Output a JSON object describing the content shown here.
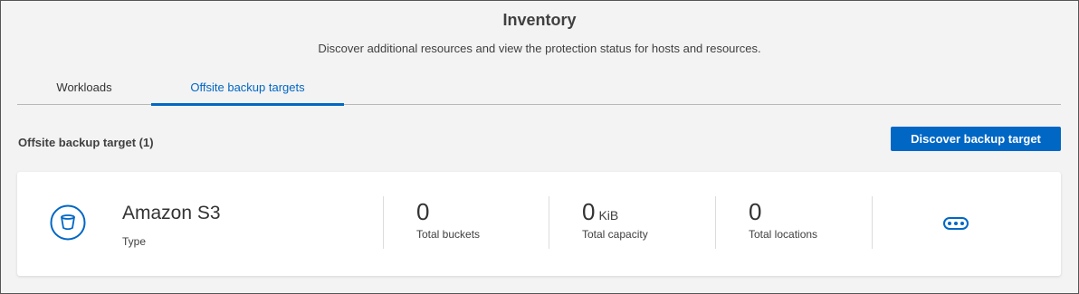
{
  "header": {
    "title": "Inventory",
    "subtitle": "Discover additional resources and view the protection status for hosts and resources."
  },
  "tabs": [
    {
      "label": "Workloads",
      "active": false
    },
    {
      "label": "Offsite backup targets",
      "active": true
    }
  ],
  "section": {
    "title": "Offsite backup target (1)",
    "action_label": "Discover backup target"
  },
  "target": {
    "icon": "bucket-icon",
    "name": "Amazon S3",
    "type_label": "Type",
    "metrics": [
      {
        "value": "0",
        "unit": "",
        "label": "Total buckets"
      },
      {
        "value": "0",
        "unit": "KiB",
        "label": "Total capacity"
      },
      {
        "value": "0",
        "unit": "",
        "label": "Total locations"
      }
    ],
    "more_icon": "more-options-icon"
  },
  "colors": {
    "accent": "#0067c5",
    "background": "#f3f3f3",
    "card": "#ffffff",
    "text": "#333333"
  }
}
